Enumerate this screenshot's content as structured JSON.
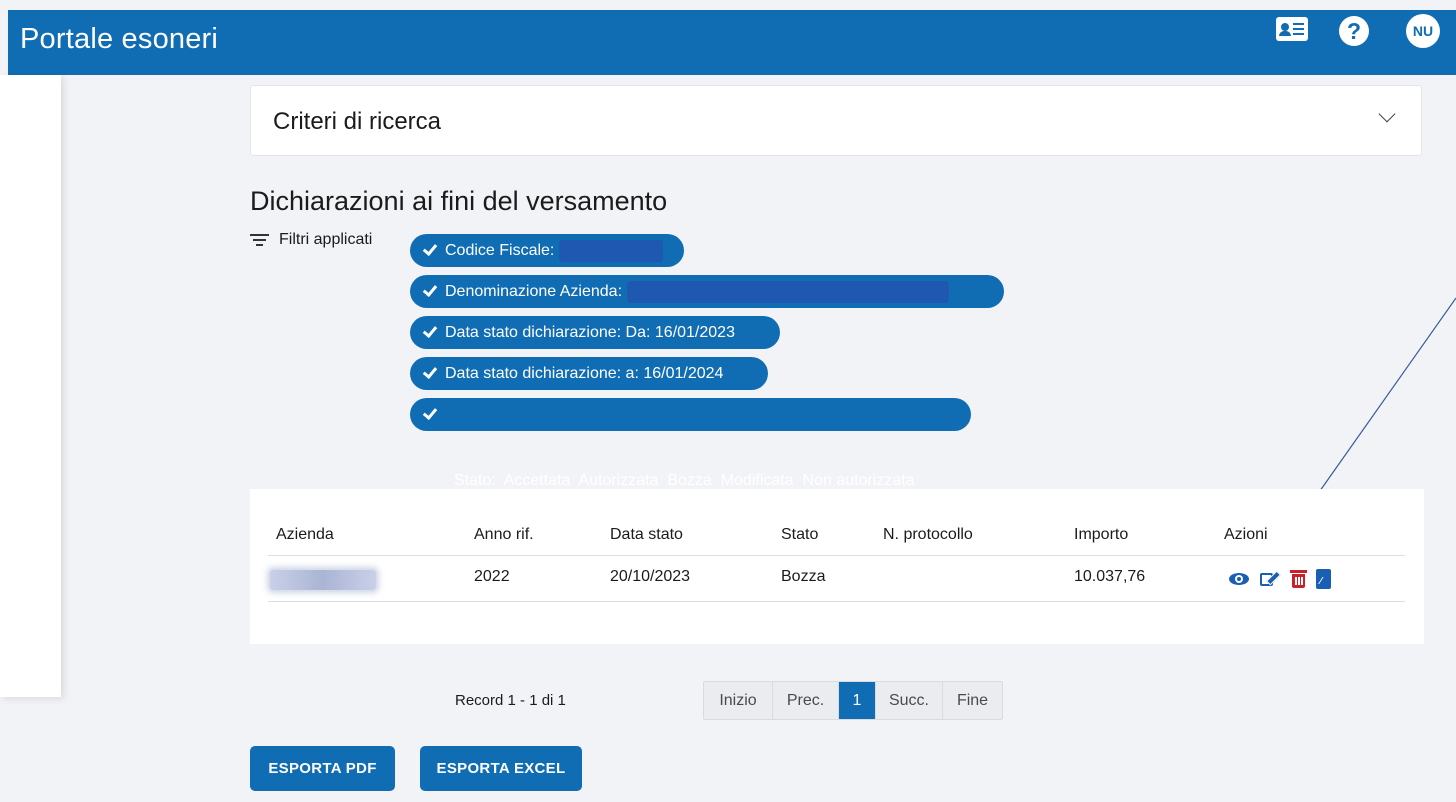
{
  "app": {
    "title": "Portale esoneri",
    "user_initials": "NU"
  },
  "search": {
    "label": "Criteri di ricerca"
  },
  "section": {
    "heading": "Dichiarazioni ai fini del versamento"
  },
  "filters": {
    "label": "Filtri applicati",
    "chips": [
      {
        "label": "Codice Fiscale:"
      },
      {
        "label": "Denominazione Azienda:"
      },
      {
        "label": "Data stato dichiarazione: Da: 16/01/2023"
      },
      {
        "label": "Data stato dichiarazione: a: 16/01/2024"
      },
      {
        "label": "Stato:  Accettata  Autorizzata  Bozza  Modificata  Non autorizzata"
      }
    ]
  },
  "table": {
    "columns": [
      "Azienda",
      "Anno rif.",
      "Data stato",
      "Stato",
      "N. protocollo",
      "Importo",
      "Azioni"
    ],
    "rows": [
      {
        "anno": "2022",
        "data_stato": "20/10/2023",
        "stato": "Bozza",
        "protocollo": "",
        "importo": "10.037,76"
      }
    ]
  },
  "pagination": {
    "record_info": "Record 1 - 1 di 1",
    "first": "Inizio",
    "prev": "Prec.",
    "current": "1",
    "next": "Succ.",
    "last": "Fine"
  },
  "buttons": {
    "export_pdf": "ESPORTA PDF",
    "export_excel": "ESPORTA EXCEL"
  },
  "icons": {
    "header": [
      "id-card-icon",
      "help-icon"
    ],
    "actions": [
      "eye-icon",
      "edit-icon",
      "trash-icon",
      "pdf-icon"
    ],
    "filters": "filter-icon",
    "chip": "check-icon",
    "criteria": "chevron-down-icon"
  },
  "colors": {
    "primary": "#106db4",
    "delete": "#c9202a",
    "background": "#f2f3f6"
  }
}
